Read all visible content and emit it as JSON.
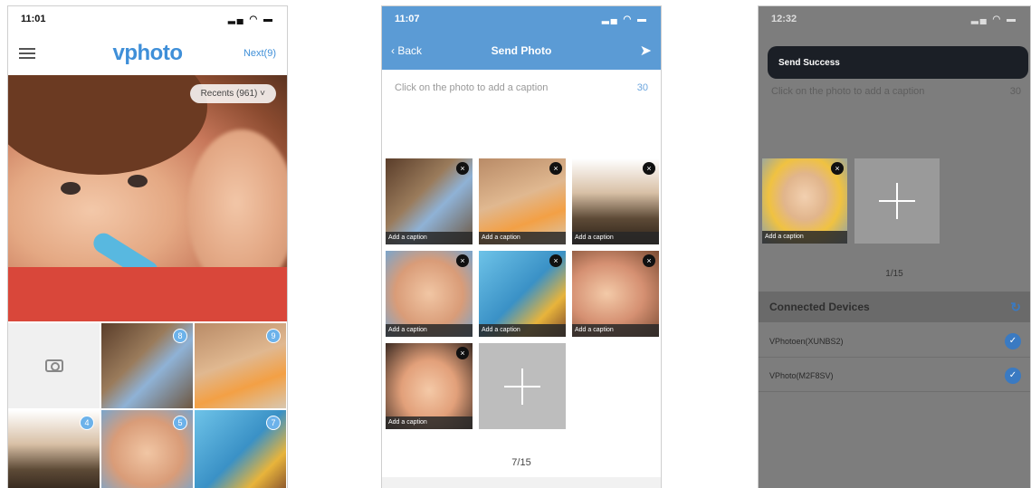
{
  "screens": {
    "home": {
      "status": {
        "time": "11:01",
        "icons": "▂▄ ◠ ▬"
      },
      "logo": "vphoto",
      "next_label": "Next(9)",
      "recents_label": "Recents (961) ˅",
      "grid_badges": [
        "8",
        "9",
        "4",
        "5",
        "7"
      ]
    },
    "send": {
      "status": {
        "time": "11:07",
        "icons": "▂▄ ◠ ▬"
      },
      "back_label": "‹ Back",
      "title": "Send Photo",
      "caption_prompt": "Click on the photo to add a caption",
      "caption_count": "30",
      "add_caption_label": "Add a caption",
      "remove_glyph": "×",
      "counter": "7/15"
    },
    "success": {
      "status": {
        "time": "12:32",
        "icons": "▂▄ ◠ ▬"
      },
      "toast": "Send Success",
      "caption_prompt": "Click on the photo to add a caption",
      "caption_count": "30",
      "add_caption_label": "Add a caption",
      "counter": "1/15",
      "devices_title": "Connected Devices",
      "devices": [
        {
          "name": "VPhotoen(XUNBS2)"
        },
        {
          "name": "VPhoto(M2F8SV)"
        }
      ]
    }
  }
}
